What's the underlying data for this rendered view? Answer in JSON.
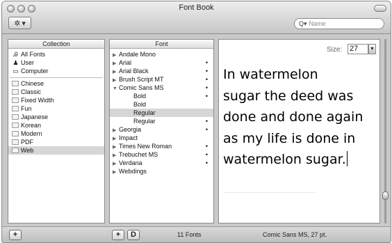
{
  "window": {
    "title": "Font Book"
  },
  "toolbar": {
    "action_icon": "gear-icon",
    "action_arrow": "▾"
  },
  "search": {
    "placeholder": "Name",
    "value": ""
  },
  "collection": {
    "header": "Collection",
    "libraries": [
      {
        "label": "All Fonts",
        "icon": "all-fonts-icon"
      },
      {
        "label": "User",
        "icon": "user-icon"
      },
      {
        "label": "Computer",
        "icon": "computer-icon"
      }
    ],
    "items": [
      "Chinese",
      "Classic",
      "Fixed Width",
      "Fun",
      "Japanese",
      "Korean",
      "Modern",
      "PDF",
      "Web"
    ],
    "selected": "Web"
  },
  "fonts": {
    "header": "Font",
    "rows": [
      {
        "label": "Andale Mono",
        "type": "family",
        "expanded": false,
        "dot": false
      },
      {
        "label": "Arial",
        "type": "family",
        "expanded": false,
        "dot": true
      },
      {
        "label": "Arial Black",
        "type": "family",
        "expanded": false,
        "dot": true
      },
      {
        "label": "Brush Script MT",
        "type": "family",
        "expanded": false,
        "dot": true
      },
      {
        "label": "Comic Sans MS",
        "type": "family",
        "expanded": true,
        "dot": true
      },
      {
        "label": "Bold",
        "type": "face",
        "dot": true
      },
      {
        "label": "Bold",
        "type": "face",
        "dot": false
      },
      {
        "label": "Regular",
        "type": "face",
        "dot": false,
        "selected": true
      },
      {
        "label": "Regular",
        "type": "face",
        "dot": true
      },
      {
        "label": "Georgia",
        "type": "family",
        "expanded": false,
        "dot": true
      },
      {
        "label": "Impact",
        "type": "family",
        "expanded": false,
        "dot": false
      },
      {
        "label": "Times New Roman",
        "type": "family",
        "expanded": false,
        "dot": true
      },
      {
        "label": "Trebuchet MS",
        "type": "family",
        "expanded": false,
        "dot": true
      },
      {
        "label": "Verdana",
        "type": "family",
        "expanded": false,
        "dot": true
      },
      {
        "label": "Webdings",
        "type": "family",
        "expanded": false,
        "dot": false
      }
    ]
  },
  "preview": {
    "size_label": "Size:",
    "size_value": "27",
    "sample_lines": [
      "In watermelon",
      "sugar the deed was",
      "done and done again",
      "as my life is done in",
      "watermelon sugar."
    ]
  },
  "status": {
    "font_count": "11 Fonts",
    "font_info": "Comic Sans MS, 27 pt.",
    "add_collection": "+",
    "add_font": "+",
    "disable_font": "D"
  }
}
